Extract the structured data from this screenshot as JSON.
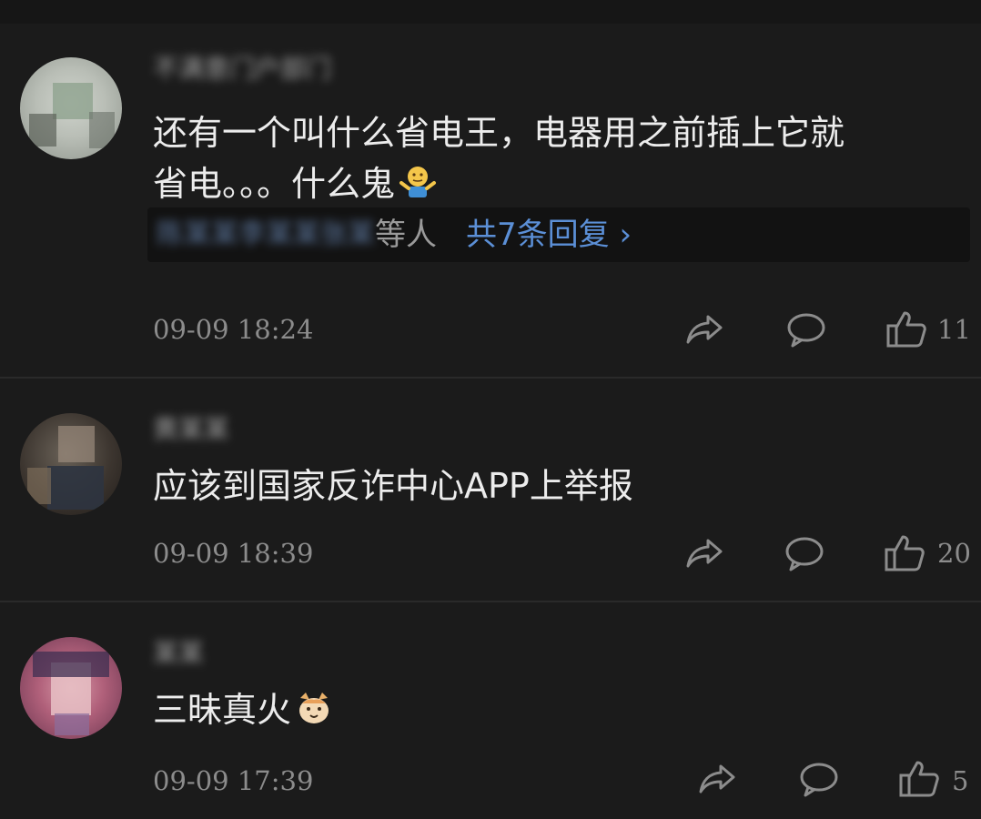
{
  "comments": [
    {
      "username": "不满意门户部门",
      "content_line1": "还有一个叫什么省电王，电器用之前插上它就",
      "content_line2": "省电。。。什么鬼",
      "content_emoji": "shrug-emoji",
      "reply_names": "陈某某李某某张某某",
      "reply_etc": "等人",
      "reply_link": "共7条回复 ›",
      "time": "09-09 18:24",
      "likes": "11"
    },
    {
      "username": "黄某某",
      "content": "应该到国家反诈中心APP上举报",
      "time": "09-09 18:39",
      "likes": "20"
    },
    {
      "username": "某某",
      "content": "三昧真火",
      "content_emoji": "cat-emoji",
      "time": "09-09 17:39",
      "likes": "5"
    }
  ],
  "colors": {
    "background": "#1b1b1b",
    "text": "#ececec",
    "meta": "#8c8c8c",
    "link": "#5b8fd6"
  },
  "icons": [
    "share-icon",
    "comment-icon",
    "like-icon"
  ]
}
